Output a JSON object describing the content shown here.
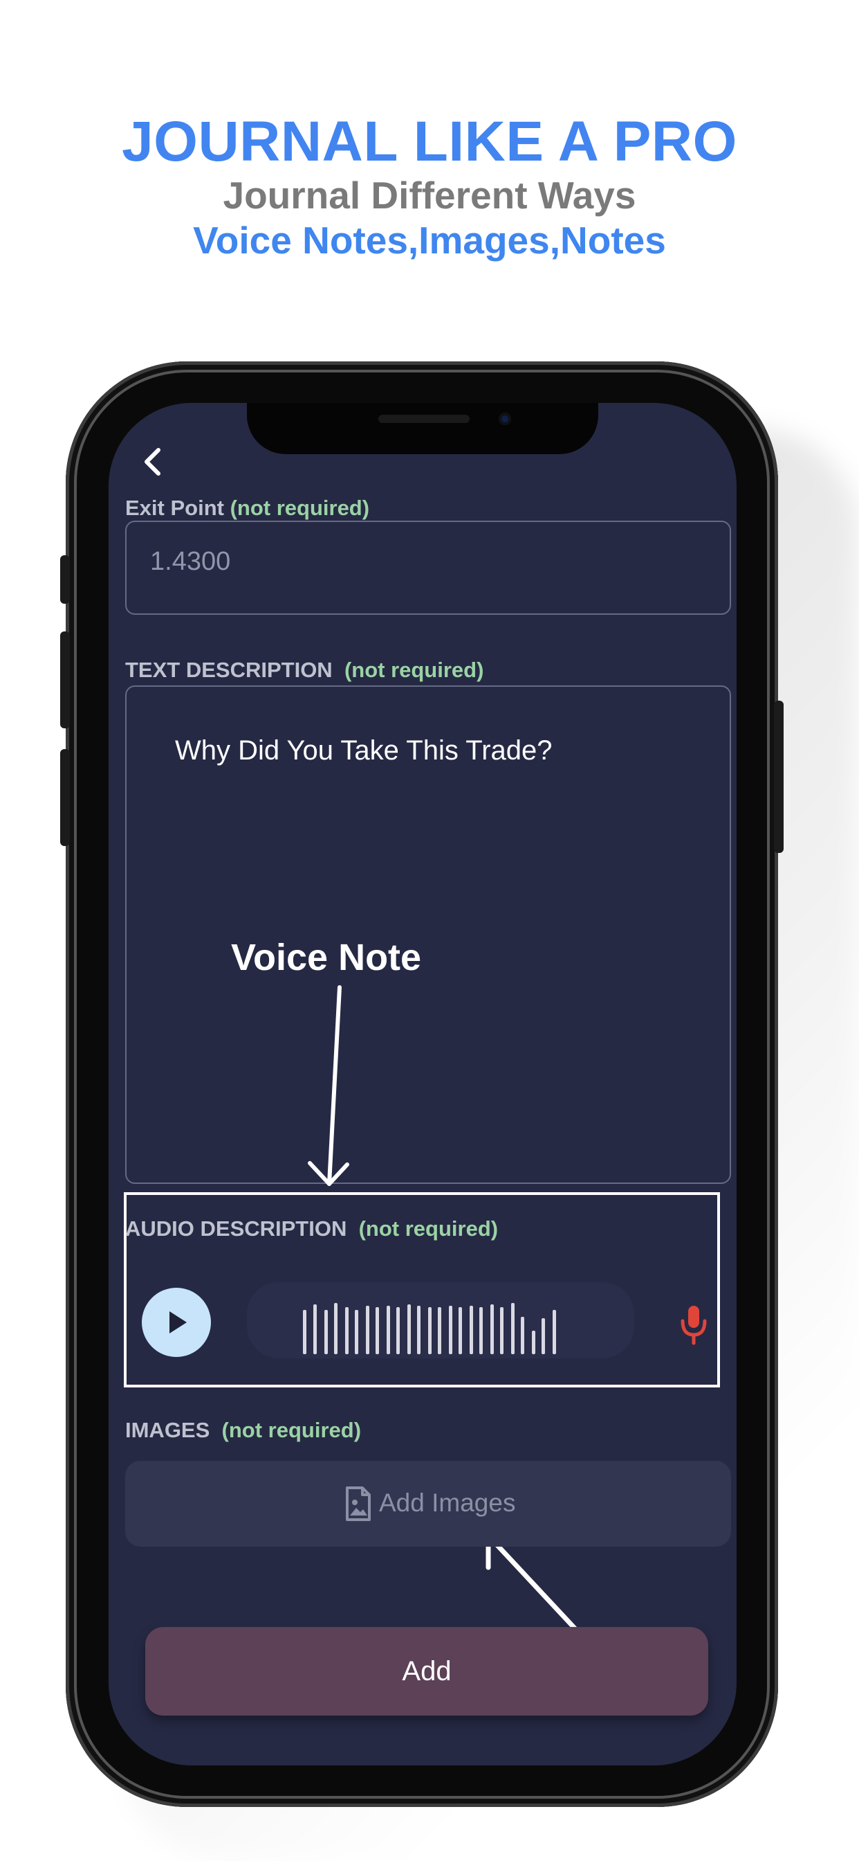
{
  "header": {
    "title": "JOURNAL LIKE A PRO",
    "subtitle": "Journal Different Ways",
    "tagline": "Voice Notes,Images,Notes"
  },
  "app": {
    "back_icon": "chevron-left-icon",
    "exit_point": {
      "label": "Exit Point",
      "required_note": "(not required)",
      "value": "1.4300"
    },
    "text_description": {
      "label": "TEXT DESCRIPTION",
      "required_note": "(not required)",
      "placeholder": "Why Did You Take This Trade?"
    },
    "audio_description": {
      "label": "AUDIO DESCRIPTION",
      "required_note": "(not required)",
      "play_icon": "play-icon",
      "mic_icon": "microphone-icon"
    },
    "images": {
      "label": "IMAGES",
      "required_note": "(not required)",
      "button_label": "Add Images",
      "button_icon": "image-file-icon"
    },
    "submit_label": "Add"
  },
  "annotations": {
    "voice_note": "Voice Note"
  },
  "colors": {
    "headline_blue": "#4285f0",
    "subtitle_gray": "#7a7a7a",
    "screen_bg": "#262944",
    "required_green": "#9bd3a5",
    "add_button": "#5c4157",
    "mic_red": "#e0453a"
  }
}
